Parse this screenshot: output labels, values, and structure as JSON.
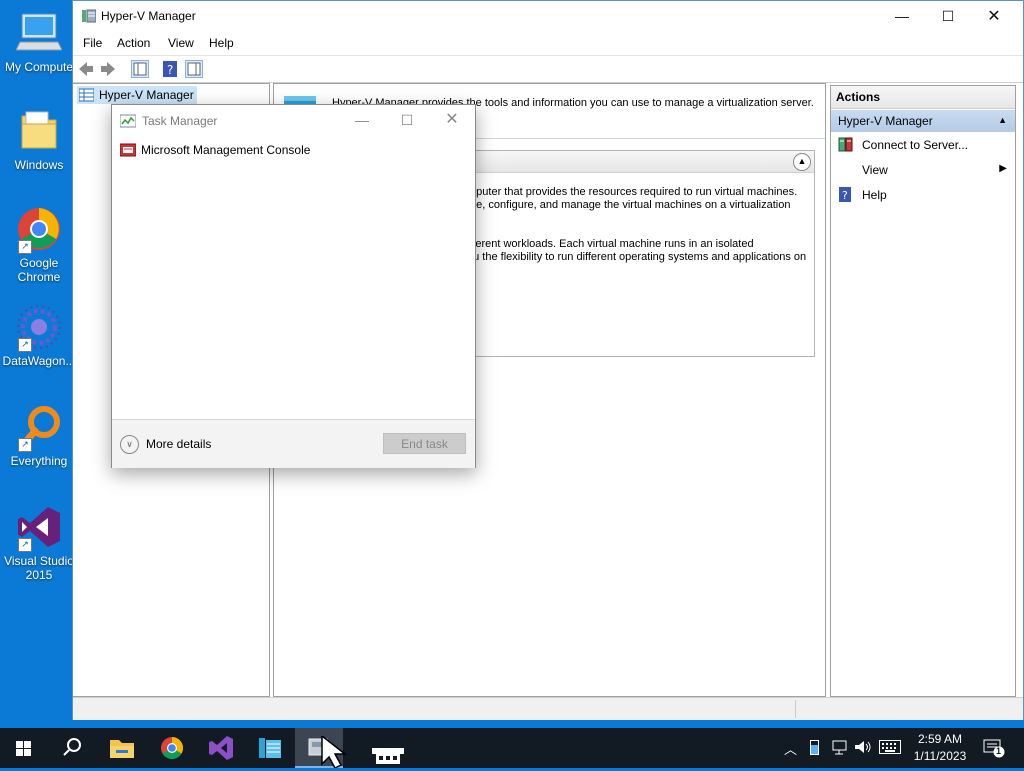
{
  "desktop": {
    "icons": [
      {
        "label": "My Compute",
        "icon": "computer-icon"
      },
      {
        "label": "Windows",
        "icon": "folder-icon"
      },
      {
        "label": "Google Chrome",
        "icon": "chrome-icon"
      },
      {
        "label": "DataWagon...",
        "icon": "datawagon-icon"
      },
      {
        "label": "Everything",
        "icon": "everything-icon"
      },
      {
        "label": "Visual Studio 2015",
        "icon": "visual-studio-icon"
      }
    ]
  },
  "hyperv": {
    "title": "Hyper-V Manager",
    "menu": [
      "File",
      "Action",
      "View",
      "Help"
    ],
    "tree_root": "Hyper-V Manager",
    "banner": "Hyper-V Manager provides the tools and information you can use to manage a virtualization server.",
    "intro_line1": "mputer that provides the resources required to run virtual machines.",
    "intro_line2": "ate, configure, and manage the virtual machines on a virtualization",
    "intro_line3": "ifferent workloads. Each virtual machine runs in an isolated",
    "intro_line4": "ou the flexibility to run different operating systems and applications on",
    "actions": {
      "header": "Actions",
      "section": "Hyper-V Manager",
      "items": [
        "Connect to Server...",
        "View",
        "Help"
      ]
    }
  },
  "taskmanager": {
    "title": "Task Manager",
    "process": "Microsoft Management Console",
    "more_details": "More details",
    "end_task": "End task"
  },
  "taskbar": {
    "time": "2:59 AM",
    "date": "1/11/2023",
    "notification_count": "1"
  },
  "colors": {
    "desktop": "#0b7ad6",
    "taskbar": "#121a24",
    "accent": "#2a6cc6"
  }
}
